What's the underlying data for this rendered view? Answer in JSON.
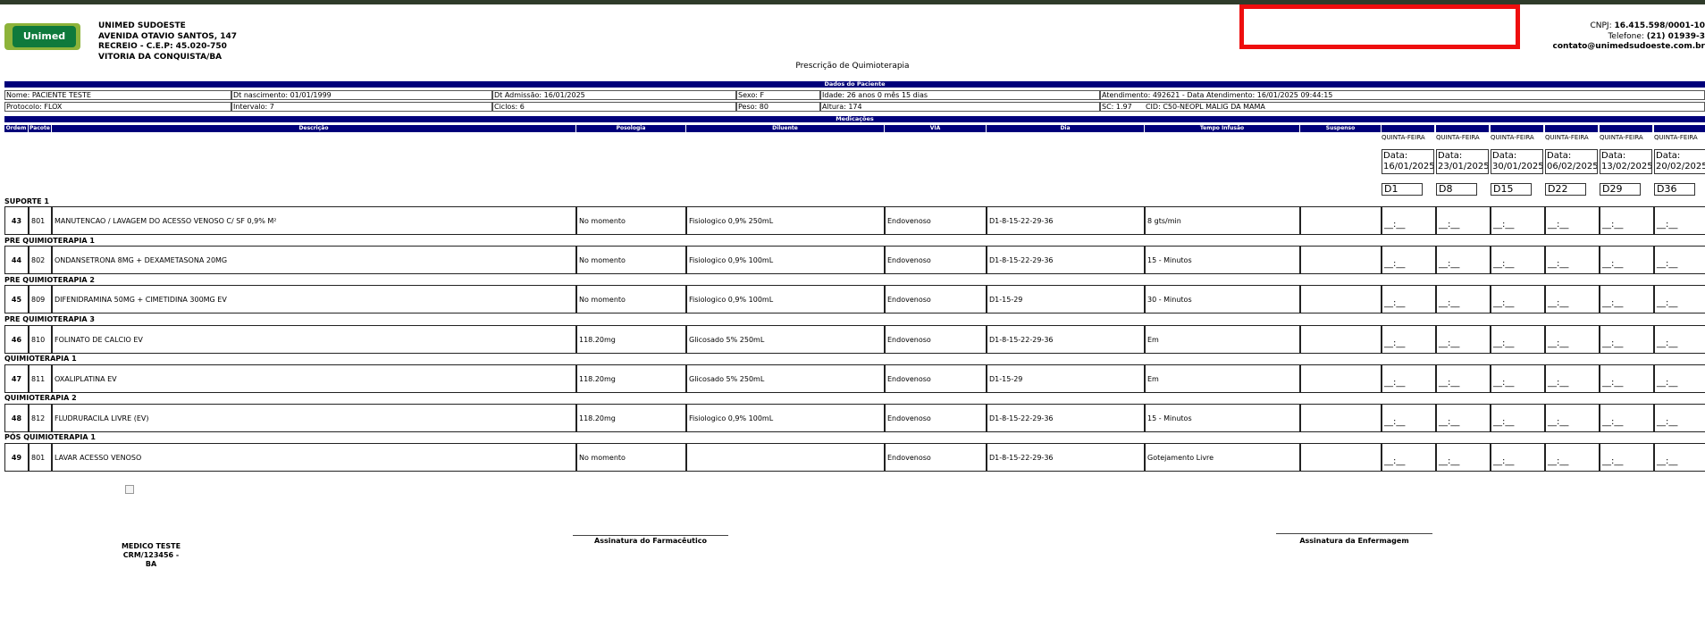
{
  "header": {
    "logo_text": "Unimed",
    "company": [
      "UNIMED SUDOESTE",
      "AVENIDA OTAVIO SANTOS, 147",
      "RECREIO - C.E.P: 45.020-750",
      "VITORIA DA CONQUISTA/BA"
    ],
    "cnpj_label": "CNPJ: ",
    "cnpj_value": "16.415.598/0001-10",
    "phone_label": "Telefone: ",
    "phone_value": "(21) 01939-3",
    "email": "contato@unimedsudoeste.com.br",
    "redbox_color": "#ee0e0e"
  },
  "document_title": "Prescrição de Quimioterapia",
  "patient": {
    "section_title": "Dados do Paciente",
    "row1": [
      "Nome: PACIENTE TESTE",
      "Dt nascimento: 01/01/1999",
      "Dt Admissão: 16/01/2025",
      "Sexo: F",
      "Idade: 26 anos 0 mês 15 dias",
      "Atendimento: 492621 - Data Atendimento: 16/01/2025 09:44:15"
    ],
    "row2": [
      "Protocolo: FLOX",
      "Intervalo: 7",
      "Ciclos: 6",
      "Peso: 80",
      "Altura: 174",
      "SC: 1.97      CID: C50-NEOPL MALIG DA MAMA"
    ]
  },
  "medications": {
    "section_title": "Medicações",
    "columns": [
      "Ordem",
      "Pacote",
      "Descrição",
      "Posologia",
      "Diluente",
      "VIA",
      "Dia",
      "Tempo Infusão",
      "Suspenso"
    ],
    "schedule": [
      {
        "weekday": "QUINTA-FEIRA",
        "date_label": "Data:",
        "date": "16/01/2025",
        "day": "D1"
      },
      {
        "weekday": "QUINTA-FEIRA",
        "date_label": "Data:",
        "date": "23/01/2025",
        "day": "D8"
      },
      {
        "weekday": "QUINTA-FEIRA",
        "date_label": "Data:",
        "date": "30/01/2025",
        "day": "D15"
      },
      {
        "weekday": "QUINTA-FEIRA",
        "date_label": "Data:",
        "date": "06/02/2025",
        "day": "D22"
      },
      {
        "weekday": "QUINTA-FEIRA",
        "date_label": "Data:",
        "date": "13/02/2025",
        "day": "D29"
      },
      {
        "weekday": "QUINTA-FEIRA",
        "date_label": "Data:",
        "date": "20/02/2025",
        "day": "D36"
      }
    ],
    "time_placeholder": "__:__",
    "groups": [
      {
        "title": "SUPORTE 1",
        "ordem": "43",
        "pacote": "801",
        "descricao": "MANUTENCAO / LAVAGEM DO ACESSO VENOSO C/ SF 0,9% M²",
        "posologia": "No momento",
        "diluente": "Fisiologico 0,9% 250mL",
        "via": "Endovenoso",
        "dia": "D1-8-15-22-29-36",
        "tempo": "8 gts/min",
        "suspenso": ""
      },
      {
        "title": "PRE QUIMIOTERAPIA 1",
        "ordem": "44",
        "pacote": "802",
        "descricao": "ONDANSETRONA 8MG + DEXAMETASONA 20MG",
        "posologia": "No momento",
        "diluente": "Fisiologico 0,9% 100mL",
        "via": "Endovenoso",
        "dia": "D1-8-15-22-29-36",
        "tempo": "15 - Minutos",
        "suspenso": ""
      },
      {
        "title": "PRE QUIMIOTERAPIA 2",
        "ordem": "45",
        "pacote": "809",
        "descricao": "DIFENIDRAMINA 50MG + CIMETIDINA 300MG EV",
        "posologia": "No momento",
        "diluente": "Fisiologico 0,9% 100mL",
        "via": "Endovenoso",
        "dia": "D1-15-29",
        "tempo": "30 - Minutos",
        "suspenso": ""
      },
      {
        "title": "PRE QUIMIOTERAPIA 3",
        "ordem": "46",
        "pacote": "810",
        "descricao": "FOLINATO DE CALCIO EV",
        "posologia": "118.20mg",
        "diluente": "Glicosado 5% 250mL",
        "via": "Endovenoso",
        "dia": "D1-8-15-22-29-36",
        "tempo": "Em",
        "suspenso": ""
      },
      {
        "title": "QUIMIOTERAPIA 1",
        "ordem": "47",
        "pacote": "811",
        "descricao": "OXALIPLATINA EV",
        "posologia": "118.20mg",
        "diluente": "Glicosado 5% 250mL",
        "via": "Endovenoso",
        "dia": "D1-15-29",
        "tempo": "Em",
        "suspenso": ""
      },
      {
        "title": "QUIMIOTERAPIA 2",
        "ordem": "48",
        "pacote": "812",
        "descricao": "FLUDRURACILA LIVRE (EV)",
        "posologia": "118.20mg",
        "diluente": "Fisiologico 0,9% 100mL",
        "via": "Endovenoso",
        "dia": "D1-8-15-22-29-36",
        "tempo": "15 - Minutos",
        "suspenso": ""
      },
      {
        "title": "PÓS QUIMIOTERAPIA 1",
        "ordem": "49",
        "pacote": "801",
        "descricao": "LAVAR ACESSO VENOSO",
        "posologia": "No momento",
        "diluente": "",
        "via": "Endovenoso",
        "dia": "D1-8-15-22-29-36",
        "tempo": "Gotejamento Livre",
        "suspenso": ""
      }
    ]
  },
  "signatures": {
    "pharmacist": "Assinatura do Farmacêutico",
    "nursing": "Assinatura da Enfermagem",
    "doctor_name": "MEDICO TESTE",
    "doctor_crm": "CRM/123456 - BA"
  }
}
